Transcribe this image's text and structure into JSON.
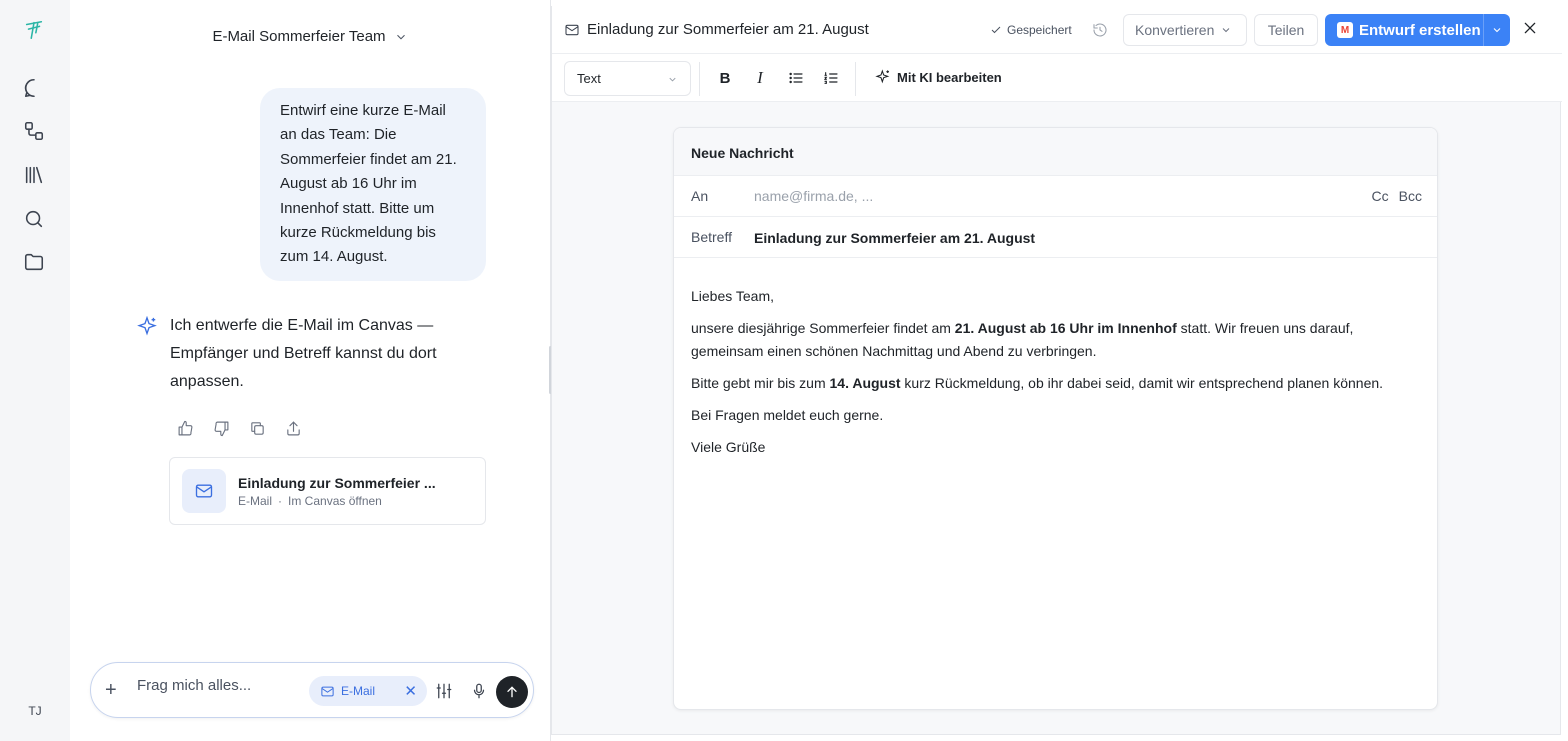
{
  "rail": {
    "user_initials": "TJ"
  },
  "chat": {
    "title": "E-Mail Sommerfeier Team",
    "user_message": "Entwirf eine kurze E-Mail an das Team: Die Sommerfeier findet am 21. August ab 16 Uhr im Innenhof statt. Bitte um kurze Rückmeldung bis zum 14. August.",
    "assistant_message": "Ich entwerfe die E-Mail im Canvas — Empfänger und Betreff kannst du dort anpassen.",
    "artifact": {
      "title": "Einladung zur Sommerfeier ...",
      "type": "E-Mail",
      "separator": "·",
      "action": "Im Canvas öffnen"
    },
    "composer": {
      "placeholder": "Frag mich alles...",
      "chip_label": "E-Mail"
    }
  },
  "canvas": {
    "doc_title": "Einladung zur Sommerfeier am 21. August",
    "saved_label": "Gespeichert",
    "convert_label": "Konvertieren",
    "share_label": "Teilen",
    "create_draft_label": "Entwurf erstellen",
    "format_select": "Text",
    "bold_label": "B",
    "italic_label": "I",
    "ai_edit_label": "Mit KI bearbeiten",
    "email": {
      "header": "Neue Nachricht",
      "to_label": "An",
      "to_placeholder": "name@firma.de, ...",
      "cc_label": "Cc",
      "bcc_label": "Bcc",
      "subject_label": "Betreff",
      "subject": "Einladung zur Sommerfeier am 21. August",
      "greeting": "Liebes Team,",
      "p1_a": "unsere diesjährige Sommerfeier findet am ",
      "p1_bold": "21. August ab 16 Uhr im Innenhof",
      "p1_b": " statt. Wir freuen uns darauf, gemeinsam einen schönen Nachmittag und Abend zu verbringen.",
      "p2_a": "Bitte gebt mir bis zum ",
      "p2_bold": "14. August",
      "p2_b": " kurz Rückmeldung, ob ihr dabei seid, damit wir entsprechend planen können.",
      "p3": "Bei Fragen meldet euch gerne.",
      "closing": "Viele Grüße"
    }
  },
  "colors": {
    "accent": "#3b82f6",
    "user_bubble": "#eef3fb",
    "rail_bg": "#f5f6f8"
  }
}
